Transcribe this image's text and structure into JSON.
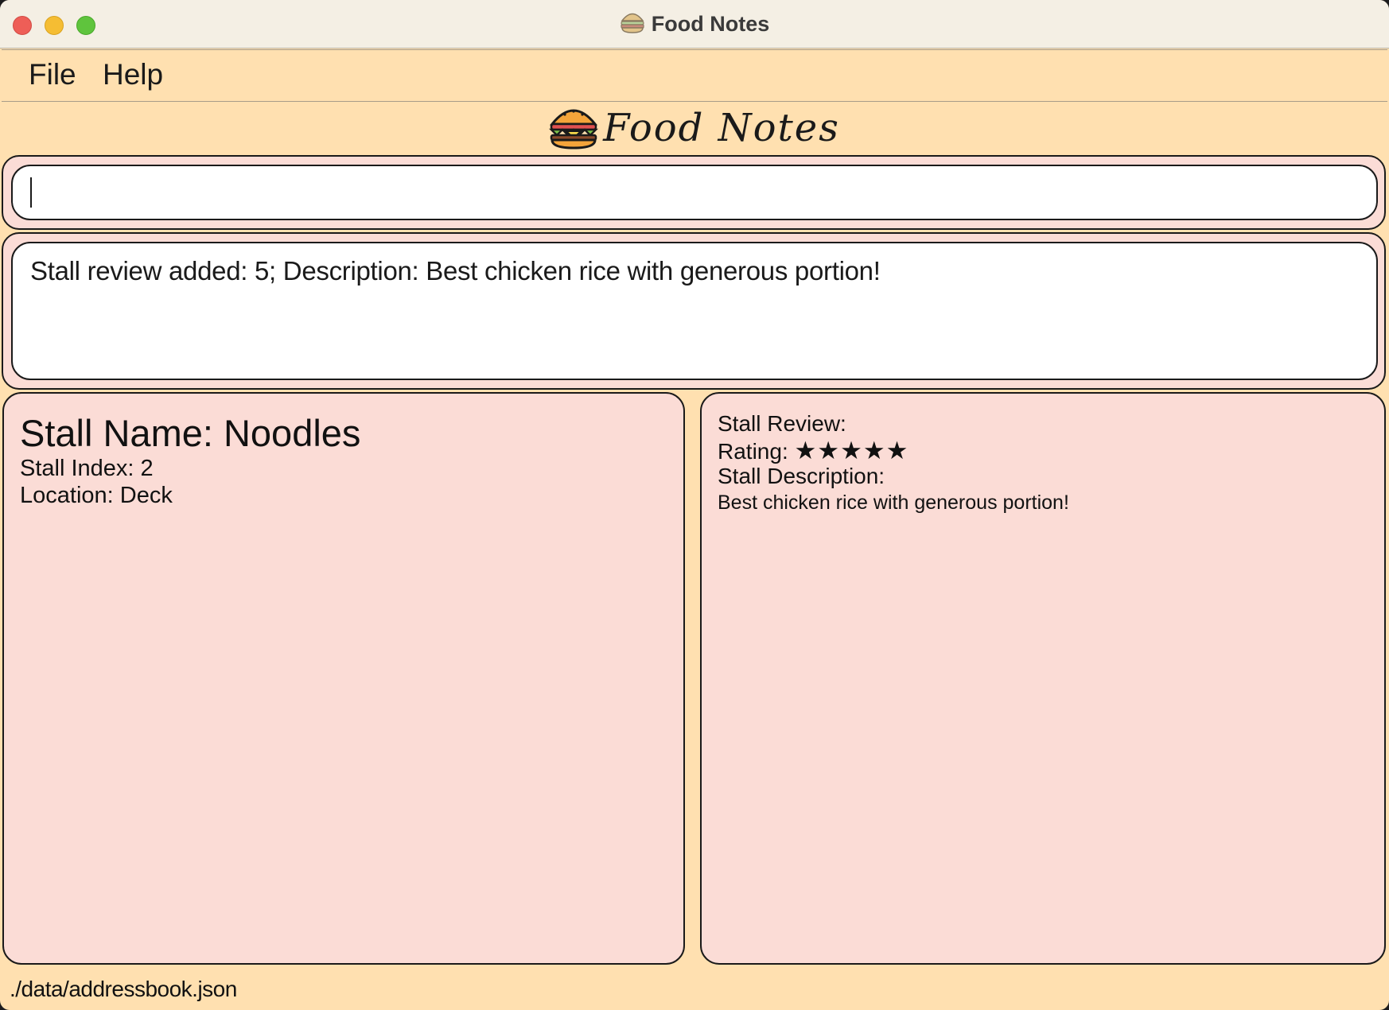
{
  "window": {
    "title": "Food Notes"
  },
  "menu": {
    "items": [
      "File",
      "Help"
    ]
  },
  "logo": {
    "text": "Food Notes"
  },
  "command": {
    "value": ""
  },
  "result": {
    "text": "Stall review added: 5; Description: Best chicken rice with generous portion!"
  },
  "stall": {
    "name_label": "Stall Name: Noodles",
    "index_label": "Stall Index: 2",
    "location_label": "Location: Deck"
  },
  "review": {
    "heading": "Stall Review:",
    "rating_label": "Rating:",
    "rating_value": 5,
    "stars": "★★★★★",
    "description_label": "Stall Description:",
    "description": "Best chicken rice with generous portion!"
  },
  "status": {
    "file_path": "./data/addressbook.json"
  },
  "colors": {
    "background": "#ffe0b0",
    "panel": "#fbdcd6",
    "border": "#1a1a1a"
  }
}
